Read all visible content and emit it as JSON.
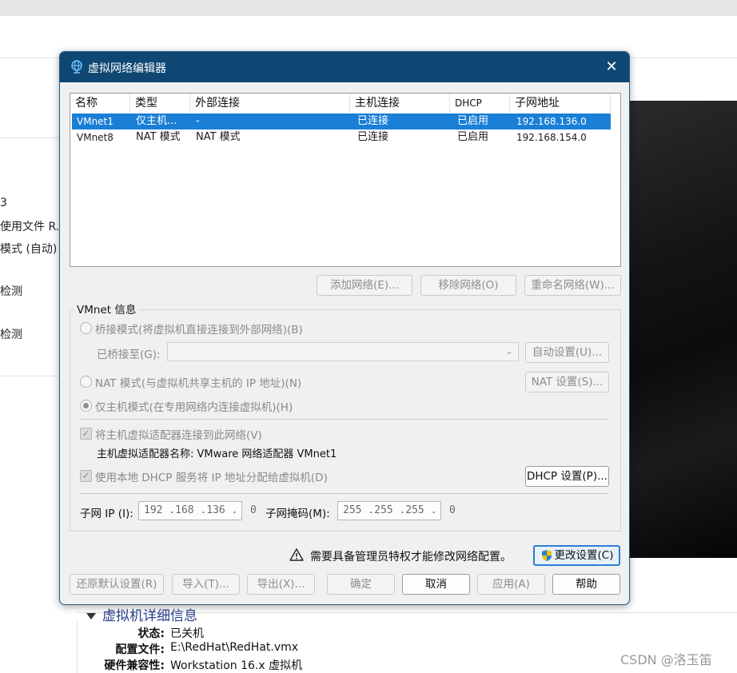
{
  "background": {
    "sidebar_fragments": [
      "3",
      "使用文件 R...",
      "模式 (自动)",
      "检测",
      "检测"
    ],
    "details": {
      "title": "虚拟机详细信息",
      "rows": [
        {
          "key": "状态:",
          "value": "已关机"
        },
        {
          "key": "配置文件:",
          "value": "E:\\RedHat\\RedHat.vmx"
        },
        {
          "key": "硬件兼容性:",
          "value": "Workstation 16.x 虚拟机"
        }
      ]
    },
    "watermark": "CSDN @洛玉笛"
  },
  "dialog": {
    "title": "虚拟网络编辑器",
    "close_symbol": "✕",
    "table": {
      "columns": [
        "名称",
        "类型",
        "外部连接",
        "主机连接",
        "DHCP",
        "子网地址"
      ],
      "rows": [
        [
          "VMnet1",
          "仅主机...",
          "-",
          "已连接",
          "已启用",
          "192.168.136.0"
        ],
        [
          "VMnet8",
          "NAT 模式",
          "NAT 模式",
          "已连接",
          "已启用",
          "192.168.154.0"
        ]
      ],
      "selected_row": 0
    },
    "buttons": {
      "add_network": "添加网络(E)...",
      "remove_network": "移除网络(O)",
      "rename_network": "重命名网络(W)...",
      "auto_settings": "自动设置(U)...",
      "nat_settings": "NAT 设置(S)...",
      "dhcp_settings": "DHCP 设置(P)...",
      "change_settings": "更改设置(C)",
      "restore_defaults": "还原默认设置(R)",
      "import": "导入(T)...",
      "export": "导出(X)...",
      "ok": "确定",
      "cancel": "取消",
      "apply": "应用(A)",
      "help": "帮助"
    },
    "vmnet_info": {
      "group_label": "VMnet 信息",
      "bridged_label": "桥接模式(将虚拟机直接连接到外部网络)(B)",
      "bridged_to_label": "已桥接至(G):",
      "bridged_to_value": "",
      "nat_label": "NAT 模式(与虚拟机共享主机的 IP 地址)(N)",
      "host_only_label": "仅主机模式(在专用网络内连接虚拟机)(H)",
      "selected_mode": "host_only",
      "connect_adapter_label": "将主机虚拟适配器连接到此网络(V)",
      "connect_adapter_checked": true,
      "adapter_name_label": "主机虚拟适配器名称: VMware 网络适配器 VMnet1",
      "use_dhcp_label": "使用本地 DHCP 服务将 IP 地址分配给虚拟机(D)",
      "use_dhcp_checked": true,
      "subnet_ip_label": "子网 IP (I):",
      "subnet_ip_value": "192 .168 .136 .  0",
      "subnet_mask_label": "子网掩码(M):",
      "subnet_mask_value": "255 .255 .255 .  0"
    },
    "admin_warning": "需要具备管理员特权才能修改网络配置。"
  }
}
